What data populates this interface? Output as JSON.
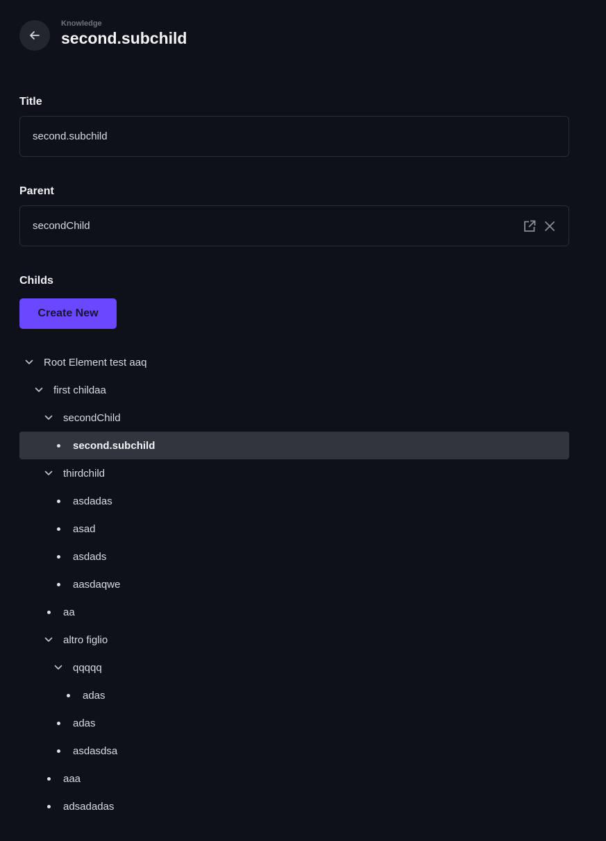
{
  "header": {
    "back_icon": "arrow-left-icon",
    "breadcrumb": "Knowledge",
    "title": "second.subchild"
  },
  "form": {
    "title_label": "Title",
    "title_value": "second.subchild",
    "parent_label": "Parent",
    "parent_value": "secondChild",
    "parent_icons": [
      "external-link-icon",
      "close-icon"
    ],
    "childs_label": "Childs",
    "create_button": "Create New"
  },
  "colors": {
    "background": "#0e111a",
    "accent": "#6a48ff",
    "selected_row": "#30353e"
  },
  "tree": [
    {
      "label": "Root Element test aaq",
      "depth": 0,
      "type": "expanded"
    },
    {
      "label": "first childaa",
      "depth": 1,
      "type": "expanded"
    },
    {
      "label": "secondChild",
      "depth": 2,
      "type": "expanded"
    },
    {
      "label": "second.subchild",
      "depth": 3,
      "type": "leaf",
      "selected": true
    },
    {
      "label": "thirdchild",
      "depth": 2,
      "type": "expanded"
    },
    {
      "label": "asdadas",
      "depth": 3,
      "type": "leaf"
    },
    {
      "label": "asad",
      "depth": 3,
      "type": "leaf"
    },
    {
      "label": "asdads",
      "depth": 3,
      "type": "leaf"
    },
    {
      "label": "aasdaqwe",
      "depth": 3,
      "type": "leaf"
    },
    {
      "label": "aa",
      "depth": 2,
      "type": "leaf"
    },
    {
      "label": "altro figlio",
      "depth": 2,
      "type": "expanded"
    },
    {
      "label": "qqqqq",
      "depth": 3,
      "type": "expanded"
    },
    {
      "label": "adas",
      "depth": 4,
      "type": "leaf"
    },
    {
      "label": "adas",
      "depth": 3,
      "type": "leaf"
    },
    {
      "label": "asdasdsa",
      "depth": 3,
      "type": "leaf"
    },
    {
      "label": "aaa",
      "depth": 2,
      "type": "leaf"
    },
    {
      "label": "adsadadas",
      "depth": 2,
      "type": "leaf"
    }
  ]
}
